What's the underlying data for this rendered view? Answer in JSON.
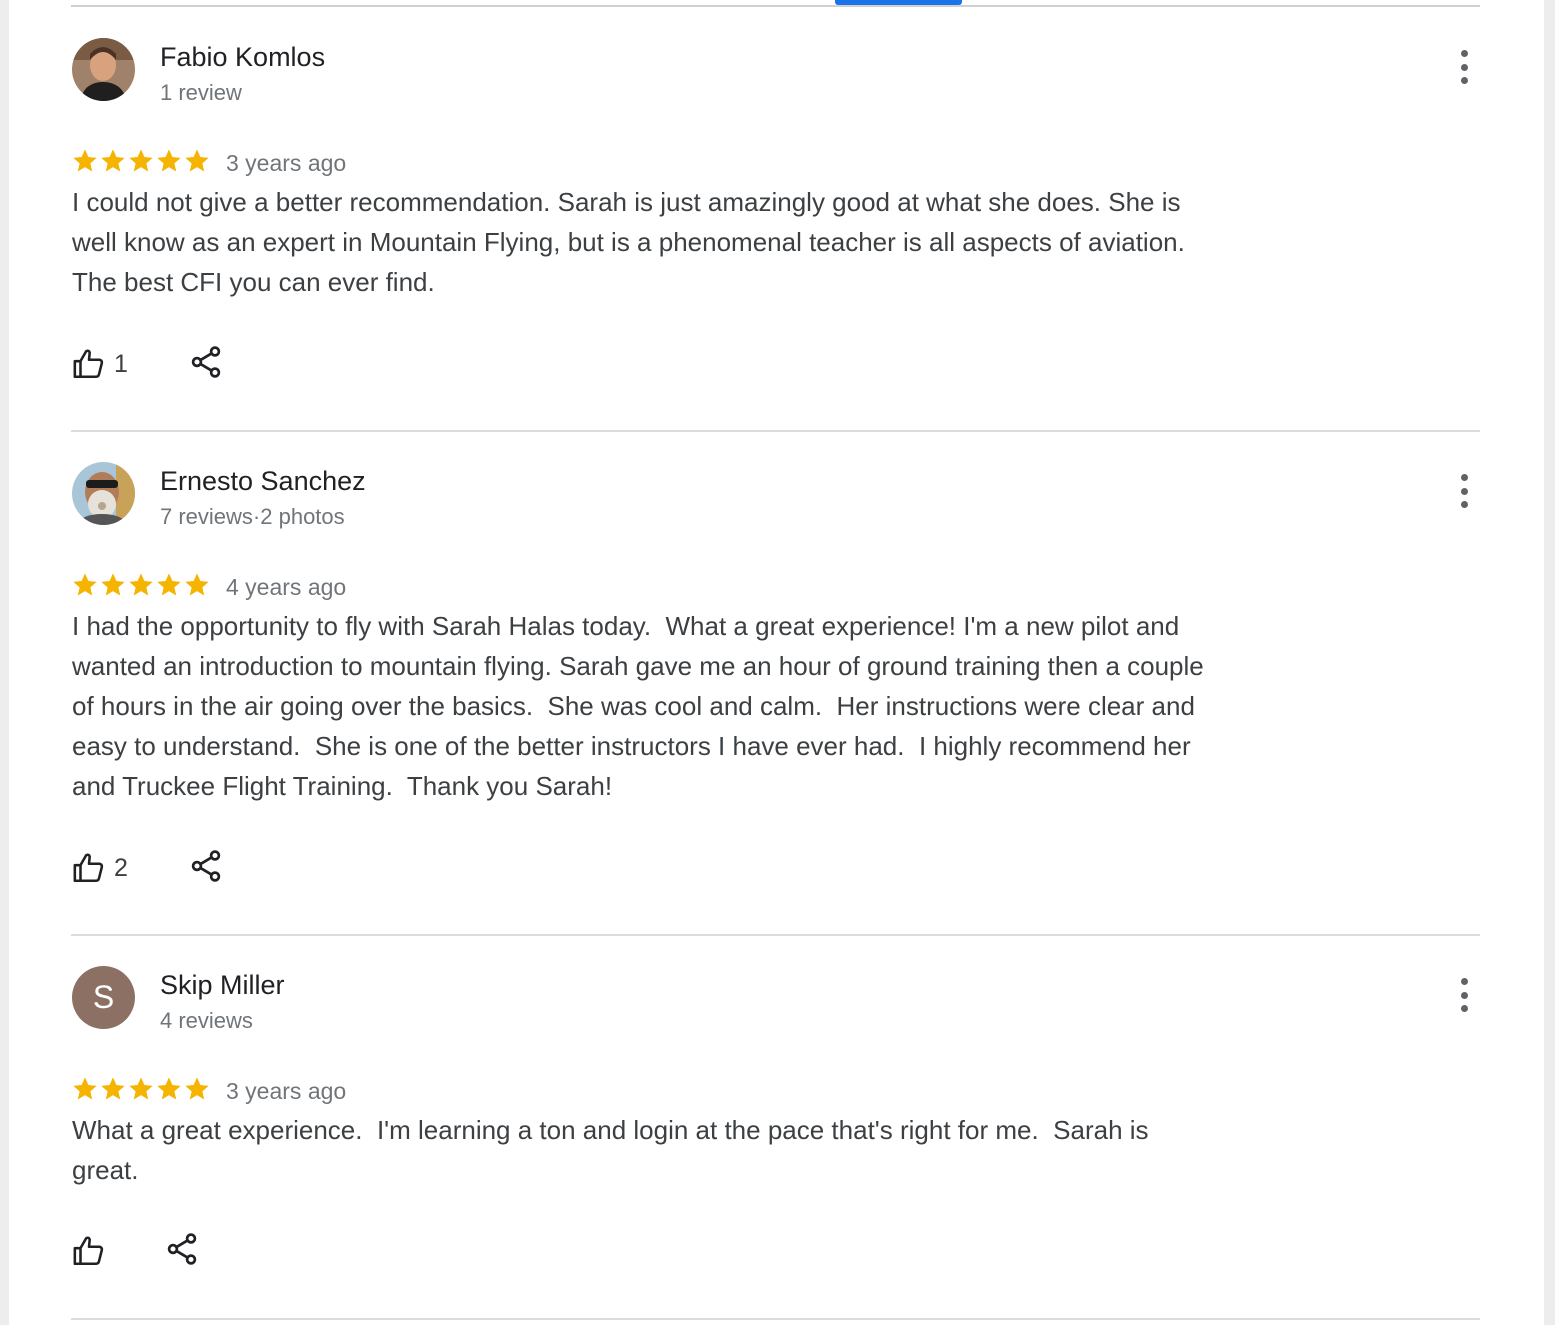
{
  "colors": {
    "accent": "#1a73e8",
    "star": "#f4b400",
    "avatar_letter_bg": "#8d7064"
  },
  "reviews": [
    {
      "name": "Fabio Komlos",
      "meta": "1 review",
      "avatar": "photo",
      "rating": 5,
      "time_ago": "3 years ago",
      "text": "I could not give a better recommendation. Sarah is just amazingly good at what she does. She is\nwell know as an expert in Mountain Flying, but is a phenomenal teacher is all aspects of aviation.\nThe best CFI you can ever find.",
      "likes": "1"
    },
    {
      "name": "Ernesto Sanchez",
      "meta": "7 reviews·2 photos",
      "avatar": "photo",
      "rating": 5,
      "time_ago": "4 years ago",
      "text": "I had the opportunity to fly with Sarah Halas today.  What a great experience! I'm a new pilot and\nwanted an introduction to mountain flying. Sarah gave me an hour of ground training then a couple\nof hours in the air going over the basics.  She was cool and calm.  Her instructions were clear and\neasy to understand.  She is one of the better instructors I have ever had.  I highly recommend her\nand Truckee Flight Training.  Thank you Sarah!",
      "likes": "2"
    },
    {
      "name": "Skip Miller",
      "meta": "4 reviews",
      "avatar": "letter",
      "avatar_letter": "S",
      "rating": 5,
      "time_ago": "3 years ago",
      "text": "What a great experience.  I'm learning a ton and login at the pace that's right for me.  Sarah is\ngreat.",
      "likes": ""
    }
  ],
  "icons": {
    "like": "thumbs-up-icon",
    "share": "share-icon",
    "more": "more-vert-icon",
    "star": "star-icon"
  }
}
